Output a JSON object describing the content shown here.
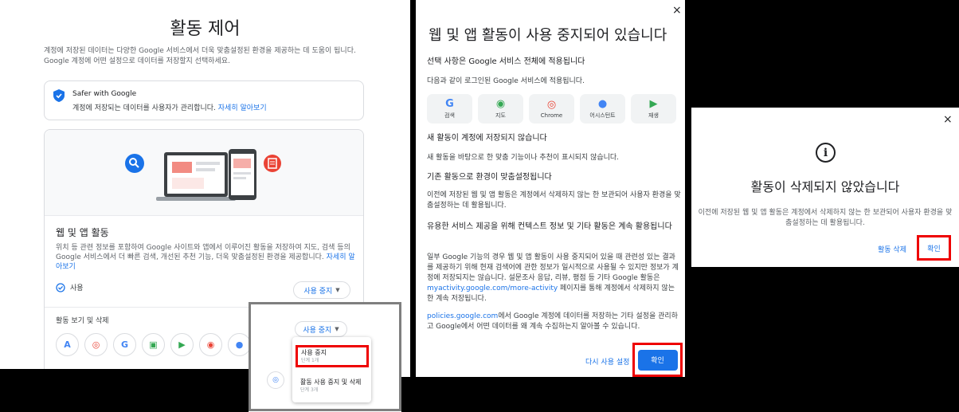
{
  "activity_controls": {
    "title": "활동 제어",
    "intro": "계정에 저장된 데이터는 다양한 Google 서비스에서 더욱 맞춤설정된 환경을 제공하는 데 도움이 됩니다. Google 계정에 어떤 설정으로 데이터를 저장할지 선택하세요.",
    "safer_title": "Safer with Google",
    "safer_desc": "계정에 저장되는 데이터를 사용자가 관리합니다.",
    "safer_link": "자세히 알아보기",
    "web_title": "웹 및 앱 활동",
    "web_desc": "위치 등 관련 정보를 포함하여 Google 사이트와 앱에서 이루어진 활동을 저장하여 지도, 검색 등의 Google 서비스에서 더 빠른 검색, 개선된 추천 기능, 더욱 맞춤설정된 환경을 제공합니다.",
    "web_link": "자세히 알아보기",
    "status": "사용",
    "toggle_label": "사용 중지",
    "view_delete": "활동 보기 및 삭제",
    "apps": [
      "A",
      "◎",
      "G",
      "▣",
      "▶",
      "◉",
      "●"
    ]
  },
  "popup": {
    "button_label": "사용 중지",
    "item1_title": "사용 중지",
    "item1_sub": "단계 1개",
    "item2_title": "활동 사용 중지 및 삭제",
    "item2_sub": "단계 3개"
  },
  "paused_dialog": {
    "close": "×",
    "title": "웹 및 앱 활동이 사용 중지되어 있습니다",
    "applies_heading": "선택 사항은 Google 서비스 전체에 적용됩니다",
    "applies_text": "다음과 같이 로그인된 Google 서비스에 적용됩니다.",
    "apps": [
      {
        "icon": "G",
        "label": "검색",
        "color": "#4285f4"
      },
      {
        "icon": "◉",
        "label": "지도",
        "color": "#34a853"
      },
      {
        "icon": "◎",
        "label": "Chrome",
        "color": "#ea4335"
      },
      {
        "icon": "●",
        "label": "어시스턴트",
        "color": "#4285f4"
      },
      {
        "icon": "▶",
        "label": "재생",
        "color": "#34a853"
      }
    ],
    "new_heading": "새 활동이 계정에 저장되지 않습니다",
    "new_text": "새 활동을 바탕으로 한 맞춤 기능이나 추천이 표시되지 않습니다.",
    "existing_heading": "기존 활동으로 환경이 맞춤설정됩니다",
    "existing_text": "이전에 저장된 웹 및 앱 활동은 계정에서 삭제하지 않는 한 보관되어 사용자 환경을 맞춤설정하는 데 활용됩니다.",
    "context_heading": "유용한 서비스 제공을 위해 컨텍스트 정보 및 기타 활동은 계속 활용됩니다",
    "context_text_a": "일부 Google 기능의 경우 웹 및 앱 활동이 사용 중지되어 있을 때 관련성 있는 결과를 제공하기 위해 현재 검색어에 관한 정보가 일시적으로 사용될 수 있지만 정보가 계정에 저장되지는 않습니다. 설문조사 응답, 리뷰, 평점 등 기타 Google 활동은",
    "context_link": "myactivity.google.com/more-activity",
    "context_text_b": "페이지를 통해 계정에서 삭제하지 않는 한 계속 저장됩니다.",
    "policies_link": "policies.google.com",
    "policies_text": "에서 Google 계정에 데이터를 저장하는 기타 설정을 관리하고 Google에서 어떤 데이터를 왜 계속 수집하는지 알아볼 수 있습니다.",
    "resume_label": "다시 사용 설정",
    "ok_label": "확인"
  },
  "not_deleted_dialog": {
    "close": "×",
    "info_icon": "i",
    "title": "활동이 삭제되지 않았습니다",
    "desc": "이전에 저장된 웹 및 앱 활동은 계정에서 삭제하지 않는 한 보관되어 사용자 환경을 맞춤설정하는 데 활용됩니다.",
    "delete_label": "활동 삭제",
    "ok_label": "확인"
  }
}
